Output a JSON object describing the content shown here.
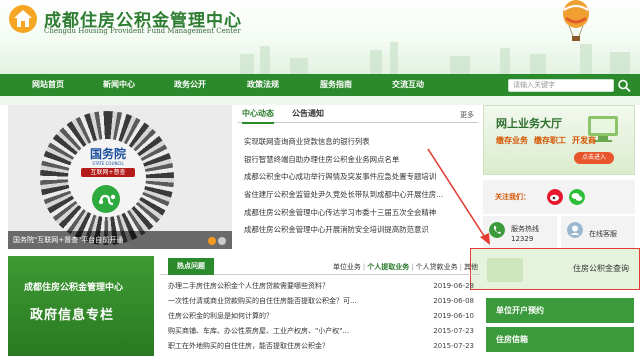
{
  "header": {
    "org_name_cn": "成都住房公积金管理中心",
    "org_name_en": "Chengdu Housing Provident Fund Management Center"
  },
  "nav": {
    "items": [
      {
        "label": "网站首页"
      },
      {
        "label": "新闻中心"
      },
      {
        "label": "政务公开"
      },
      {
        "label": "政策法规"
      },
      {
        "label": "服务指南"
      },
      {
        "label": "交流互动"
      }
    ],
    "search_placeholder": "请输入关键字"
  },
  "slideshow": {
    "brand_title": "国务院",
    "brand_sub": "STATE COUNCIL",
    "brand_tag": "互联网+督查",
    "caption": "国务院\"互联网+督查\"平台自前开通"
  },
  "news": {
    "tabs": [
      {
        "label": "中心动态",
        "active": true
      },
      {
        "label": "公告通知",
        "active": false
      }
    ],
    "more": "更多",
    "items": [
      "实现联网查询商业贷款信息的银行列表",
      "银行智慧终端自助办理住房公积金业务网点名单",
      "成都公积金中心成功举行舆情及突发事件应急处置专题培训",
      "省住建厅公积金监管处尹久竞处长带队到成都中心开展住房...",
      "成都住房公积金管理中心传达学习市委十三届五次全会精神",
      "成都住房公积金管理中心开展消防安全培训提高防范意识"
    ]
  },
  "online_hall": {
    "title": "网上业务大厅",
    "row": [
      "缴存业务",
      "缴存职工",
      "开发商"
    ],
    "button": "点击进入"
  },
  "follow": {
    "label": "关注我们："
  },
  "services": [
    {
      "line1": "服务热线",
      "line2": "12329"
    },
    {
      "line1": "在线客服",
      "line2": ""
    }
  ],
  "query": {
    "label": "住房公积金查询"
  },
  "sidebar_links": {
    "unit_open": "单位开户预约",
    "credit": "住房信箱"
  },
  "banner": {
    "line1": "成都住房公积金管理中心",
    "line2": "政府信息专栏"
  },
  "hot": {
    "tab": "热点问题",
    "links": [
      {
        "label": "单位业务",
        "active": false
      },
      {
        "label": "个人提取业务",
        "active": true
      },
      {
        "label": "个人贷款业务",
        "active": false
      },
      {
        "label": "其他",
        "active": false
      }
    ],
    "items": [
      {
        "title": "办理二手房住房公积金个人住房贷款需要哪些资料？",
        "date": "2019-06-28"
      },
      {
        "title": "一次性付清或商业贷款购买的自住住房能否提取公积金？可...",
        "date": "2019-06-08"
      },
      {
        "title": "住房公积金的利息是如何计算的？",
        "date": "2019-06-10"
      },
      {
        "title": "购买商铺、车库、办公性质房屋、工业产权房、\"小产权\"...",
        "date": "2015-07-23"
      },
      {
        "title": "职工在外地购买的自住住房，能否提取住房公积金？",
        "date": "2015-07-23"
      }
    ]
  },
  "colors": {
    "nav_green": "#2b8a2b",
    "accent_orange": "#d35400",
    "highlight_red": "#e23c33"
  }
}
